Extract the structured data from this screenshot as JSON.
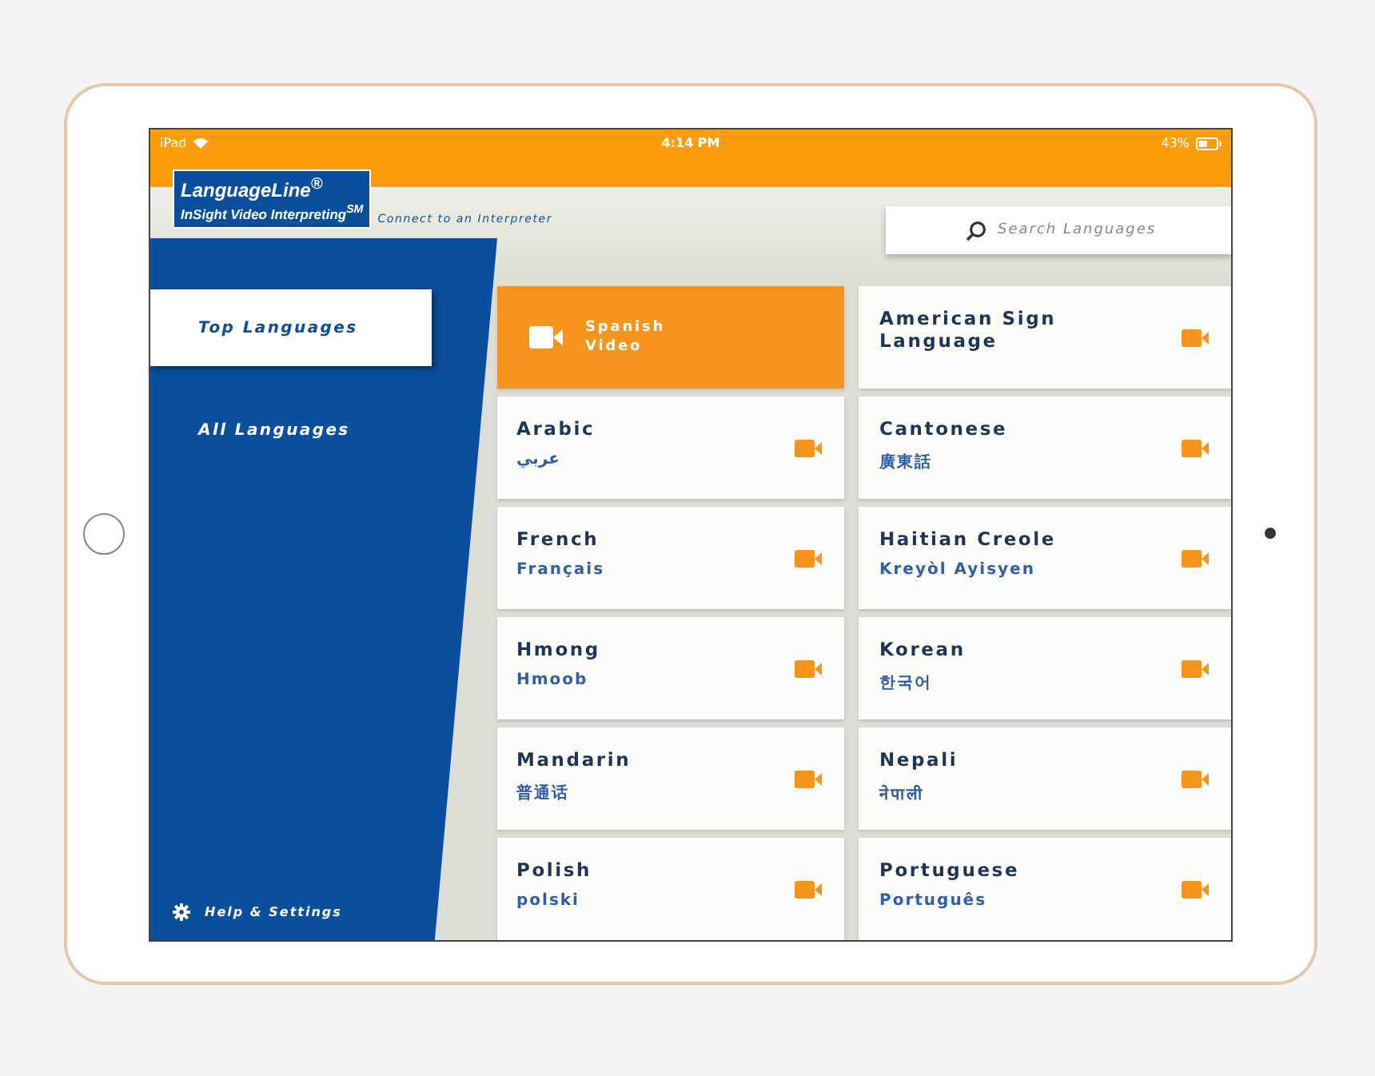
{
  "status_bar": {
    "carrier": "iPad",
    "time": "4:14 PM",
    "battery": "43%"
  },
  "header": {
    "logo_title": "LanguageLine$^{®}$",
    "logo_subtitle": "InSight Video Interpreting$^{SM}$",
    "tagline": "Connect to an Interpreter"
  },
  "search": {
    "placeholder": "Search Languages"
  },
  "sidebar": {
    "items": [
      {
        "label": "Top Languages",
        "selected": true
      },
      {
        "label": "All Languages",
        "selected": false
      }
    ],
    "footer": "Help & Settings"
  },
  "tiles": [
    {
      "kind": "featured",
      "name": "Spanish",
      "native": "Video"
    },
    {
      "kind": "language",
      "name": "American Sign Language"
    },
    {
      "kind": "language",
      "name": "Arabic",
      "native": "عربي"
    },
    {
      "kind": "language",
      "name": "Cantonese",
      "native": "廣東話"
    },
    {
      "kind": "language",
      "name": "French",
      "native": "Français"
    },
    {
      "kind": "language",
      "name": "Haitian Creole",
      "native": "Kreyòl Ayisyen"
    },
    {
      "kind": "language",
      "name": "Hmong",
      "native": "Hmoob"
    },
    {
      "kind": "language",
      "name": "Korean",
      "native": "한국어"
    },
    {
      "kind": "language",
      "name": "Mandarin",
      "native": "普通话"
    },
    {
      "kind": "language",
      "name": "Nepali",
      "native": "नेपाली"
    },
    {
      "kind": "language",
      "name": "Polish",
      "native": "polski"
    },
    {
      "kind": "language",
      "name": "Portuguese",
      "native": "Português"
    }
  ]
}
